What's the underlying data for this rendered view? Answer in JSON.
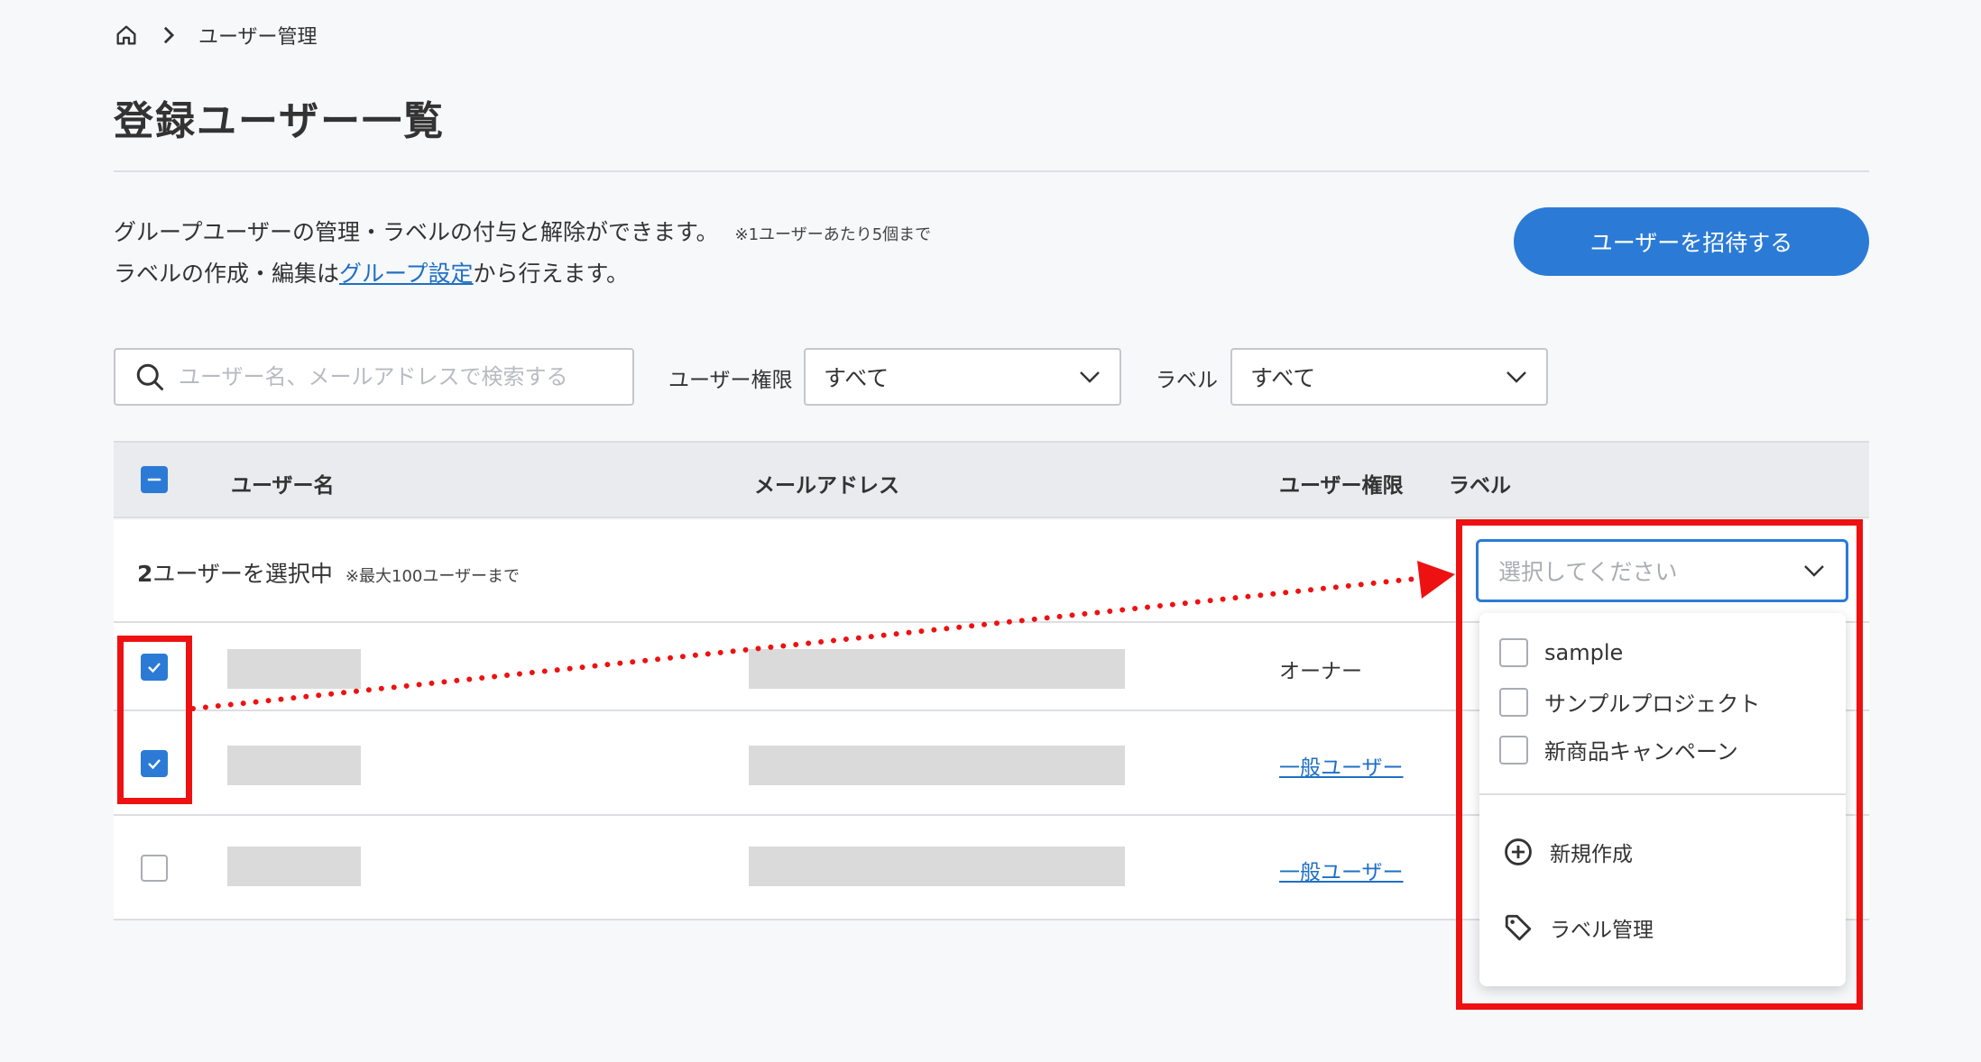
{
  "breadcrumb": {
    "current": "ユーザー管理"
  },
  "page": {
    "title": "登録ユーザー一覧",
    "desc_line1": "グループユーザーの管理・ラベルの付与と解除ができます。",
    "desc_note": "※1ユーザーあたり5個まで",
    "desc_line2_pre": "ラベルの作成・編集は",
    "desc_line2_link": "グループ設定",
    "desc_line2_post": "から行えます。",
    "invite_button": "ユーザーを招待する"
  },
  "filters": {
    "search_placeholder": "ユーザー名、メールアドレスで検索する",
    "role_label": "ユーザー権限",
    "role_value": "すべて",
    "label_label": "ラベル",
    "label_value": "すべて"
  },
  "table": {
    "headers": {
      "name": "ユーザー名",
      "email": "メールアドレス",
      "role": "ユーザー権限",
      "label": "ラベル"
    },
    "selection": {
      "count": "2",
      "text": "ユーザーを選択中",
      "note": "※最大100ユーザーまで"
    },
    "rows": [
      {
        "checked": true,
        "role": "オーナー",
        "role_is_link": false
      },
      {
        "checked": true,
        "role": "一般ユーザー",
        "role_is_link": true
      },
      {
        "checked": false,
        "role": "一般ユーザー",
        "role_is_link": true
      }
    ]
  },
  "label_dropdown": {
    "placeholder": "選択してください",
    "options": [
      "sample",
      "サンプルプロジェクト",
      "新商品キャンペーン"
    ],
    "actions": {
      "create": "新規作成",
      "manage": "ラベル管理"
    }
  },
  "colors": {
    "accent": "#2b7bd6",
    "highlight": "#ee1111",
    "link": "#1f6fc5"
  }
}
